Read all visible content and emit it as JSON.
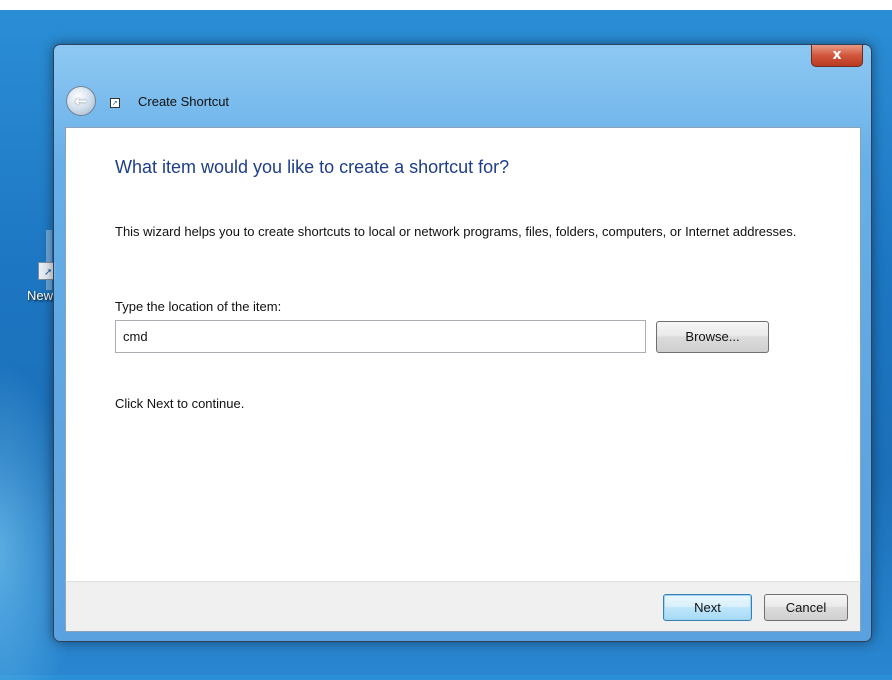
{
  "desktop": {
    "icon_label": "New"
  },
  "window": {
    "title": "Create Shortcut",
    "close_glyph": "x",
    "back_glyph": "←"
  },
  "wizard": {
    "heading": "What item would you like to create a shortcut for?",
    "description": "This wizard helps you to create shortcuts to local or network programs, files, folders, computers, or Internet addresses.",
    "location_label": "Type the location of the item:",
    "location_value": "cmd",
    "browse_label": "Browse...",
    "continue_text": "Click Next to continue."
  },
  "footer": {
    "next_label": "Next",
    "cancel_label": "Cancel"
  },
  "colors": {
    "heading": "#1e3e8a",
    "desktop": "#1d76c2",
    "close_button": "#d1563b"
  },
  "icons": [
    "back-arrow-icon",
    "shortcut-icon",
    "close-icon"
  ]
}
